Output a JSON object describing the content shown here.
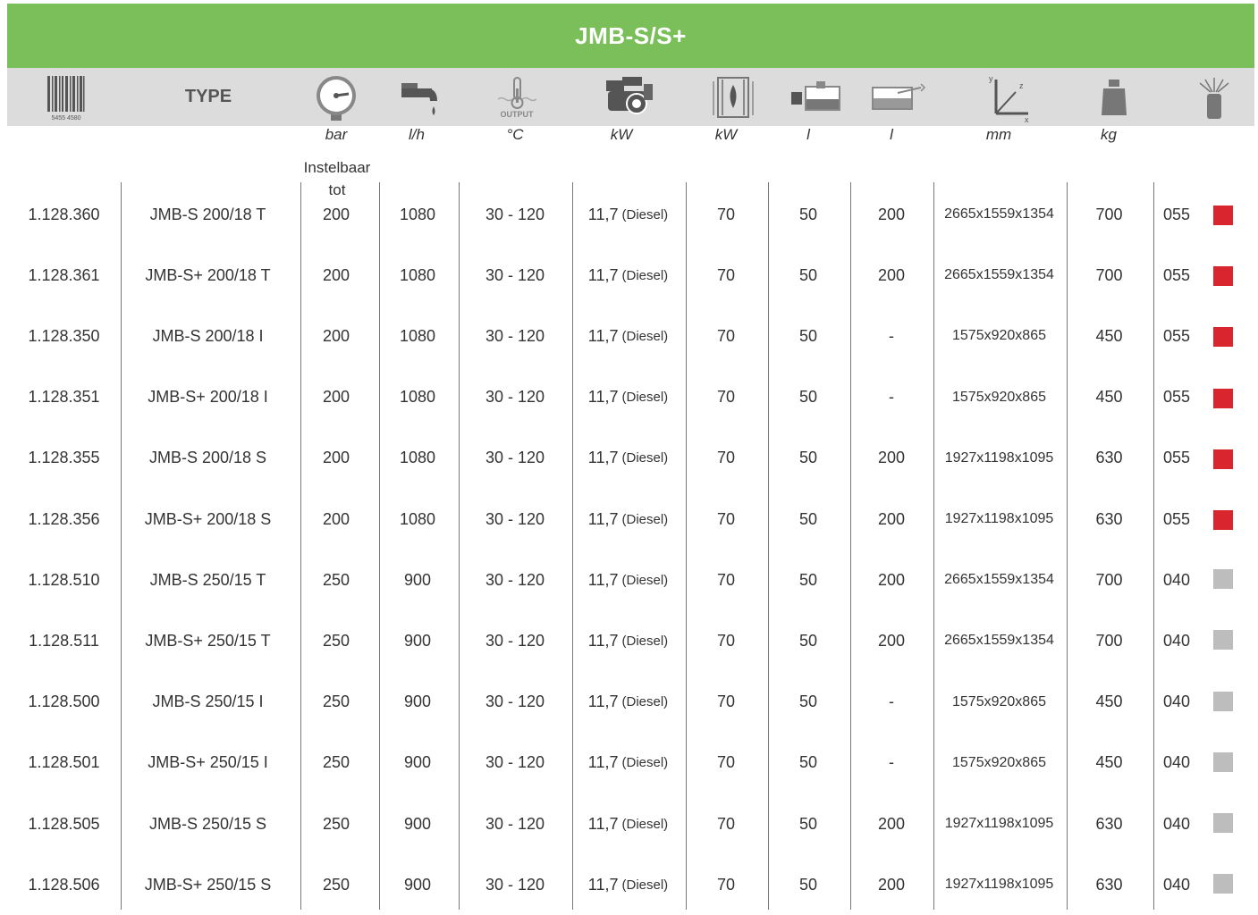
{
  "title": "JMB-S/S+",
  "header": {
    "type_label": "TYPE",
    "barcode_digits": "5455 4580",
    "thermo_label": "OUTPUT",
    "icons": [
      "barcode-icon",
      "pressure-gauge-icon",
      "water-tap-icon",
      "thermometer-icon",
      "engine-icon",
      "burner-icon",
      "fuel-tank-icon",
      "water-tank-icon",
      "dimensions-icon",
      "weight-icon",
      "nozzle-icon"
    ]
  },
  "units": [
    "bar",
    "l/h",
    "°C",
    "kW",
    "kW",
    "l",
    "l",
    "mm",
    "kg"
  ],
  "note": "Instelbaar tot",
  "colors": {
    "green": "#7bbf5a",
    "red": "#d9262e",
    "grey": "#bdbdbd"
  },
  "rows": [
    {
      "code": "1.128.360",
      "type": "JMB-S 200/18 T",
      "bar": "200",
      "flow": "1080",
      "temp": "30 - 120",
      "kw": "11,7",
      "fuel": "(Diesel)",
      "kw2": "70",
      "l1": "50",
      "l2": "200",
      "dims": "2665x1559x1354",
      "kg": "700",
      "nozzle": "055",
      "color": "red"
    },
    {
      "code": "1.128.361",
      "type": "JMB-S+ 200/18 T",
      "bar": "200",
      "flow": "1080",
      "temp": "30 - 120",
      "kw": "11,7",
      "fuel": "(Diesel)",
      "kw2": "70",
      "l1": "50",
      "l2": "200",
      "dims": "2665x1559x1354",
      "kg": "700",
      "nozzle": "055",
      "color": "red"
    },
    {
      "code": "1.128.350",
      "type": "JMB-S 200/18 I",
      "bar": "200",
      "flow": "1080",
      "temp": "30 - 120",
      "kw": "11,7",
      "fuel": "(Diesel)",
      "kw2": "70",
      "l1": "50",
      "l2": "-",
      "dims": "1575x920x865",
      "kg": "450",
      "nozzle": "055",
      "color": "red"
    },
    {
      "code": "1.128.351",
      "type": "JMB-S+ 200/18 I",
      "bar": "200",
      "flow": "1080",
      "temp": "30 - 120",
      "kw": "11,7",
      "fuel": "(Diesel)",
      "kw2": "70",
      "l1": "50",
      "l2": "-",
      "dims": "1575x920x865",
      "kg": "450",
      "nozzle": "055",
      "color": "red"
    },
    {
      "code": "1.128.355",
      "type": "JMB-S 200/18 S",
      "bar": "200",
      "flow": "1080",
      "temp": "30 - 120",
      "kw": "11,7",
      "fuel": "(Diesel)",
      "kw2": "70",
      "l1": "50",
      "l2": "200",
      "dims": "1927x1198x1095",
      "kg": "630",
      "nozzle": "055",
      "color": "red"
    },
    {
      "code": "1.128.356",
      "type": "JMB-S+ 200/18 S",
      "bar": "200",
      "flow": "1080",
      "temp": "30 - 120",
      "kw": "11,7",
      "fuel": "(Diesel)",
      "kw2": "70",
      "l1": "50",
      "l2": "200",
      "dims": "1927x1198x1095",
      "kg": "630",
      "nozzle": "055",
      "color": "red"
    },
    {
      "code": "1.128.510",
      "type": "JMB-S 250/15 T",
      "bar": "250",
      "flow": "900",
      "temp": "30 - 120",
      "kw": "11,7",
      "fuel": "(Diesel)",
      "kw2": "70",
      "l1": "50",
      "l2": "200",
      "dims": "2665x1559x1354",
      "kg": "700",
      "nozzle": "040",
      "color": "grey"
    },
    {
      "code": "1.128.511",
      "type": "JMB-S+ 250/15 T",
      "bar": "250",
      "flow": "900",
      "temp": "30 - 120",
      "kw": "11,7",
      "fuel": "(Diesel)",
      "kw2": "70",
      "l1": "50",
      "l2": "200",
      "dims": "2665x1559x1354",
      "kg": "700",
      "nozzle": "040",
      "color": "grey"
    },
    {
      "code": "1.128.500",
      "type": "JMB-S 250/15 I",
      "bar": "250",
      "flow": "900",
      "temp": "30 - 120",
      "kw": "11,7",
      "fuel": "(Diesel)",
      "kw2": "70",
      "l1": "50",
      "l2": "-",
      "dims": "1575x920x865",
      "kg": "450",
      "nozzle": "040",
      "color": "grey"
    },
    {
      "code": "1.128.501",
      "type": "JMB-S+ 250/15 I",
      "bar": "250",
      "flow": "900",
      "temp": "30 - 120",
      "kw": "11,7",
      "fuel": "(Diesel)",
      "kw2": "70",
      "l1": "50",
      "l2": "-",
      "dims": "1575x920x865",
      "kg": "450",
      "nozzle": "040",
      "color": "grey"
    },
    {
      "code": "1.128.505",
      "type": "JMB-S 250/15 S",
      "bar": "250",
      "flow": "900",
      "temp": "30 - 120",
      "kw": "11,7",
      "fuel": "(Diesel)",
      "kw2": "70",
      "l1": "50",
      "l2": "200",
      "dims": "1927x1198x1095",
      "kg": "630",
      "nozzle": "040",
      "color": "grey"
    },
    {
      "code": "1.128.506",
      "type": "JMB-S+ 250/15 S",
      "bar": "250",
      "flow": "900",
      "temp": "30 - 120",
      "kw": "11,7",
      "fuel": "(Diesel)",
      "kw2": "70",
      "l1": "50",
      "l2": "200",
      "dims": "1927x1198x1095",
      "kg": "630",
      "nozzle": "040",
      "color": "grey"
    }
  ]
}
